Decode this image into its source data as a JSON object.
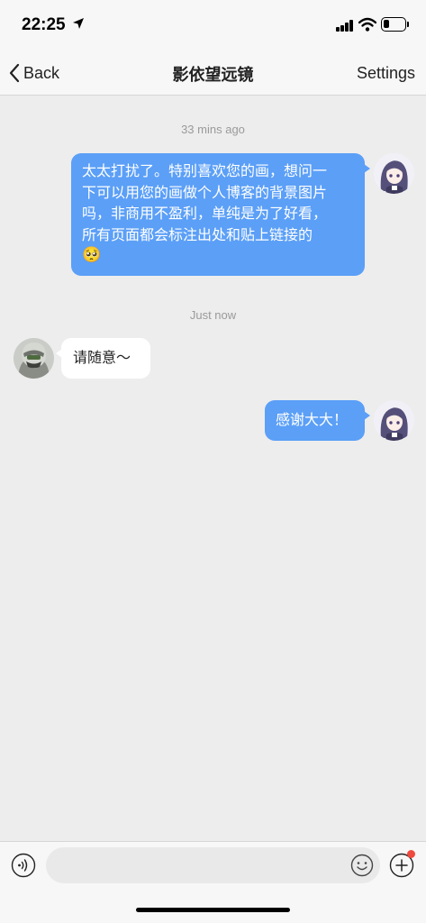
{
  "status_bar": {
    "time": "22:25",
    "battery_level": 0.3
  },
  "nav": {
    "back_label": "Back",
    "title": "影依望远镜",
    "settings_label": "Settings"
  },
  "messages": [
    {
      "timestamp": "33 mins ago",
      "direction": "outgoing",
      "lines": [
        "太太打扰了。特别喜欢您的画，想问一",
        "下可以用您的画做个人博客的背景图片",
        "吗，非商用不盈利，单纯是为了好看，",
        "所有页面都会标注出处和贴上链接的"
      ],
      "emoji": "🥺"
    },
    {
      "timestamp": "Just now",
      "direction": "incoming",
      "text": "请随意～"
    },
    {
      "direction": "outgoing",
      "text": "感谢大大！"
    }
  ],
  "input": {
    "value": "",
    "placeholder": ""
  },
  "colors": {
    "bubble_out": "#5b9ff7",
    "bubble_in": "#ffffff",
    "background": "#ededed",
    "badge": "#f04a3e"
  }
}
